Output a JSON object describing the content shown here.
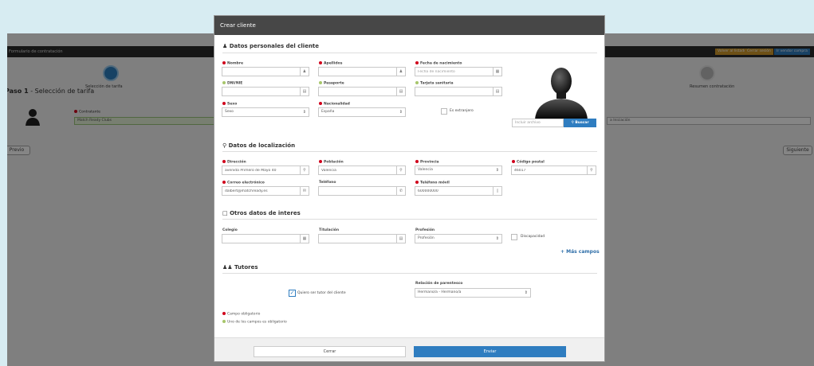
{
  "background": {
    "topbar_title": "Formulario de contratación",
    "topbar_buttons": [
      {
        "label": "Volver al listado",
        "color": "#d19a2b"
      },
      {
        "label": "Cerrar sesión",
        "color": "#d19a2b"
      },
      {
        "label": "Ir vendor compra",
        "color": "#2f7dc0"
      }
    ],
    "step1_label": "Selección de tarifa",
    "step_last_label": "Resumen contratación",
    "paso_label": "Paso 1",
    "paso_title": "Selección de tarifa",
    "contratante_label": "Contratante",
    "contratante_value": "Match Ready Clubs",
    "tarifa_value": "a Iniciación",
    "prev_button": "Previo",
    "next_button": "Siguiente"
  },
  "modal": {
    "title": "Crear cliente",
    "sections": {
      "personal": "Datos personales del cliente",
      "location": "Datos de localización",
      "other": "Otros datos de interes",
      "tutors": "Tutores"
    },
    "personal": {
      "nombre_label": "Nombre",
      "apellidos_label": "Apellidos",
      "nacimiento_label": "Fecha de nacimiento",
      "nacimiento_placeholder": "Fecha de nacimiento",
      "dni_label": "DNI/NIE",
      "pasaporte_label": "Pasaporte",
      "tarjeta_label": "Tarjeta sanitaria",
      "sexo_label": "Sexo",
      "sexo_value": "Sexo",
      "nacionalidad_label": "Nacionalidad",
      "nacionalidad_value": "España",
      "extranjero_label": "Es extranjero",
      "file_placeholder": "Incluir archivo",
      "file_button": "Buscar"
    },
    "location": {
      "direccion_label": "Dirección",
      "direccion_value": "avenida Primero de Mayo 40",
      "poblacion_label": "Población",
      "poblacion_value": "Valencia",
      "provincia_label": "Provincia",
      "provincia_value": "Valencia",
      "cp_label": "Código postal",
      "cp_value": "46017",
      "correo_label": "Correo electrónico",
      "correo_value": "dalbert@matchready.es",
      "telefono_label": "Teléfono",
      "movil_label": "Teléfono móvil",
      "movil_value": "600000000"
    },
    "other": {
      "colegio_label": "Colegio",
      "titulacion_label": "Titulación",
      "profesion_label": "Profesión",
      "profesion_value": "Profesión",
      "discapacidad_label": "Discapacidad",
      "mas_campos": "Más campos"
    },
    "tutors": {
      "tutor_check_label": "Quiero ser tutor del cliente",
      "relacion_label": "Relación de parentesco",
      "relacion_value": "Hermano/a - Hermano/a"
    },
    "legend": {
      "required": "Campo obligatorio",
      "one_of": "Uno de los campos es obligatorio"
    },
    "footer": {
      "close": "Cerrar",
      "send": "Enviar"
    },
    "colors": {
      "required_dot": "#d0021b",
      "optional_dot": "#a7c66b",
      "primary": "#2f7dc0",
      "header": "#474747"
    }
  }
}
